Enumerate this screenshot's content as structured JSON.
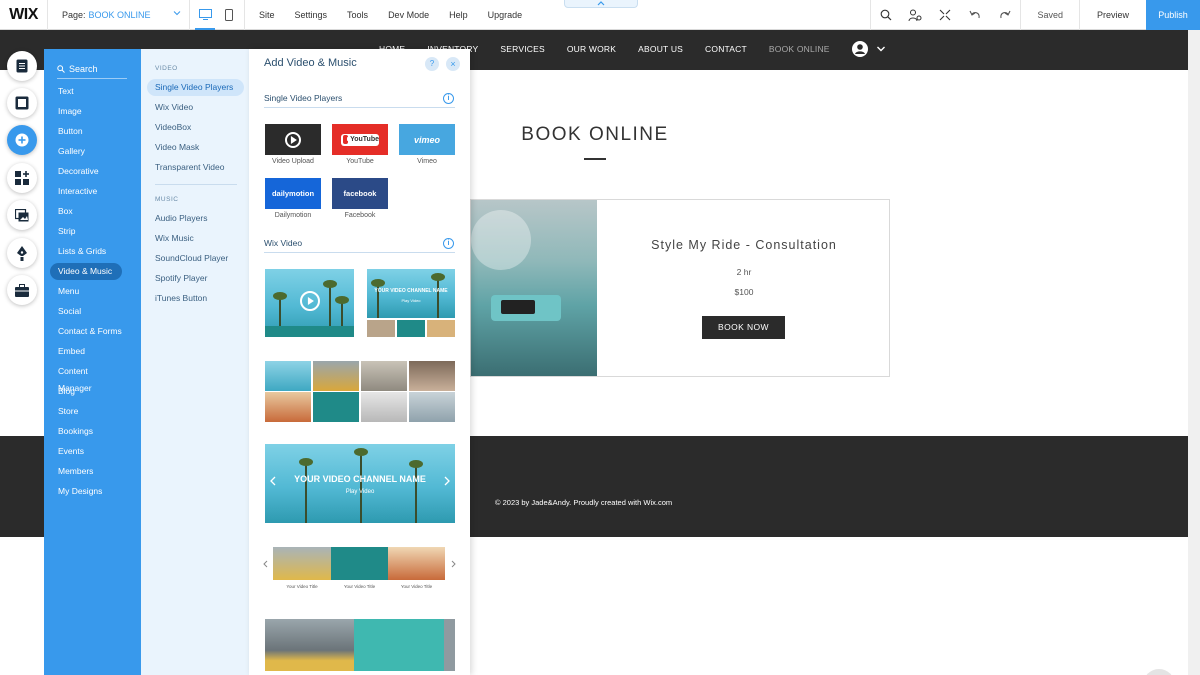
{
  "topbar": {
    "logo": "WIX",
    "page_label": "Page:",
    "page_name": "BOOK ONLINE",
    "menu": [
      "Site",
      "Settings",
      "Tools",
      "Dev Mode",
      "Help",
      "Upgrade"
    ],
    "saved": "Saved",
    "preview": "Preview",
    "publish": "Publish"
  },
  "site": {
    "nav": [
      "HOME",
      "INVENTORY",
      "SERVICES",
      "OUR WORK",
      "ABOUT US",
      "CONTACT",
      "BOOK ONLINE"
    ],
    "page_title": "BOOK ONLINE",
    "service": {
      "name": "Style My Ride - Consultation",
      "duration": "2 hr",
      "price": "$100",
      "button": "BOOK NOW"
    },
    "footer": "© 2023 by Jade&Andy. Proudly created with Wix.com"
  },
  "add_panel": {
    "search": "Search",
    "categories": [
      "Text",
      "Image",
      "Button",
      "Gallery",
      "Decorative",
      "Interactive",
      "Box",
      "Strip",
      "Lists & Grids",
      "Video & Music",
      "Menu",
      "Social",
      "Contact & Forms",
      "Embed",
      "Content Manager",
      "Blog",
      "Store",
      "Bookings",
      "Events",
      "Members",
      "My Designs"
    ],
    "active_category": "Video & Music",
    "sub": {
      "video_heading": "VIDEO",
      "video_items": [
        "Single Video Players",
        "Wix Video",
        "VideoBox",
        "Video Mask",
        "Transparent Video"
      ],
      "music_heading": "MUSIC",
      "music_items": [
        "Audio Players",
        "Wix Music",
        "SoundCloud Player",
        "Spotify Player",
        "iTunes Button"
      ]
    },
    "main": {
      "title": "Add Video & Music",
      "help": "?",
      "close": "×",
      "section1": "Single Video Players",
      "players": [
        {
          "brand": "",
          "caption": "Video Upload"
        },
        {
          "brand": "YouTube",
          "caption": "YouTube"
        },
        {
          "brand": "vimeo",
          "caption": "Vimeo"
        },
        {
          "brand": "dailymotion",
          "caption": "Dailymotion"
        },
        {
          "brand": "facebook",
          "caption": "Facebook"
        }
      ],
      "section2": "Wix Video",
      "channel_small": "YOUR VIDEO CHANNEL NAME",
      "play_video_small": "Play Video",
      "channel_big": "YOUR VIDEO CHANNEL NAME",
      "play_video_big": "Play Video",
      "video_title": "Your Video Title",
      "info": "i"
    }
  },
  "colors": {
    "accent": "#3899ec",
    "panel_sub_bg": "#eaf4fd",
    "site_dark": "#2b2b2b",
    "youtube_red": "#e52d27",
    "vimeo_blue": "#47a7e0",
    "dailymotion_blue": "#1566d9",
    "facebook_blue": "#2b4a87"
  }
}
